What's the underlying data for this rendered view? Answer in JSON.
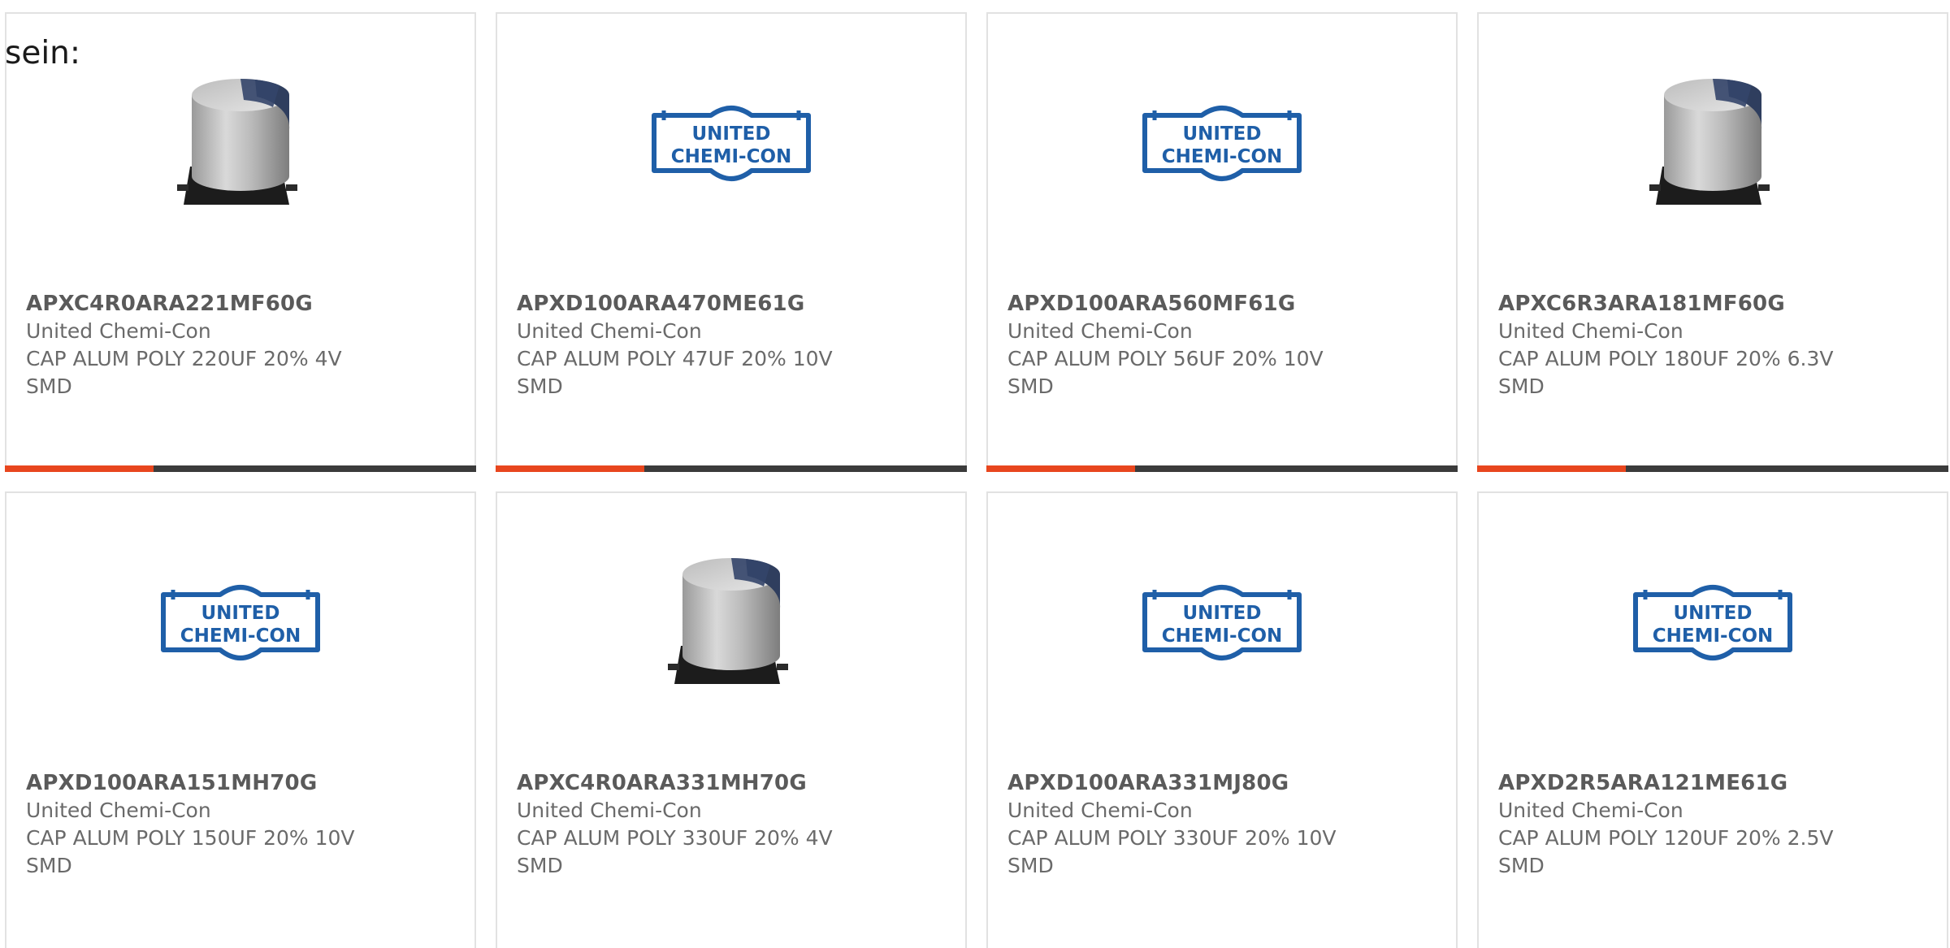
{
  "intro": "sein:",
  "colors": {
    "accent": "#e8461e",
    "bar": "#3b3b3b",
    "logo_blue": "#1f5fa8"
  },
  "products": [
    {
      "part_number": "APXC4R0ARA221MF60G",
      "manufacturer": "United Chemi-Con",
      "description": "CAP ALUM POLY 220UF 20% 4V",
      "package": "SMD",
      "image": "capacitor-photo"
    },
    {
      "part_number": "APXD100ARA470ME61G",
      "manufacturer": "United Chemi-Con",
      "description": "CAP ALUM POLY 47UF 20% 10V",
      "package": "SMD",
      "image": "manufacturer-logo",
      "logo_line1": "UNITED",
      "logo_line2": "CHEMI-CON"
    },
    {
      "part_number": "APXD100ARA560MF61G",
      "manufacturer": "United Chemi-Con",
      "description": "CAP ALUM POLY 56UF 20% 10V",
      "package": "SMD",
      "image": "manufacturer-logo",
      "logo_line1": "UNITED",
      "logo_line2": "CHEMI-CON"
    },
    {
      "part_number": "APXC6R3ARA181MF60G",
      "manufacturer": "United Chemi-Con",
      "description": "CAP ALUM POLY 180UF 20% 6.3V",
      "package": "SMD",
      "image": "capacitor-photo"
    },
    {
      "part_number": "APXD100ARA151MH70G",
      "manufacturer": "United Chemi-Con",
      "description": "CAP ALUM POLY 150UF 20% 10V",
      "package": "SMD",
      "image": "manufacturer-logo",
      "logo_line1": "UNITED",
      "logo_line2": "CHEMI-CON"
    },
    {
      "part_number": "APXC4R0ARA331MH70G",
      "manufacturer": "United Chemi-Con",
      "description": "CAP ALUM POLY 330UF 20% 4V",
      "package": "SMD",
      "image": "capacitor-photo"
    },
    {
      "part_number": "APXD100ARA331MJ80G",
      "manufacturer": "United Chemi-Con",
      "description": "CAP ALUM POLY 330UF 20% 10V",
      "package": "SMD",
      "image": "manufacturer-logo",
      "logo_line1": "UNITED",
      "logo_line2": "CHEMI-CON"
    },
    {
      "part_number": "APXD2R5ARA121ME61G",
      "manufacturer": "United Chemi-Con",
      "description": "CAP ALUM POLY 120UF 20% 2.5V",
      "package": "SMD",
      "image": "manufacturer-logo",
      "logo_line1": "UNITED",
      "logo_line2": "CHEMI-CON"
    }
  ]
}
